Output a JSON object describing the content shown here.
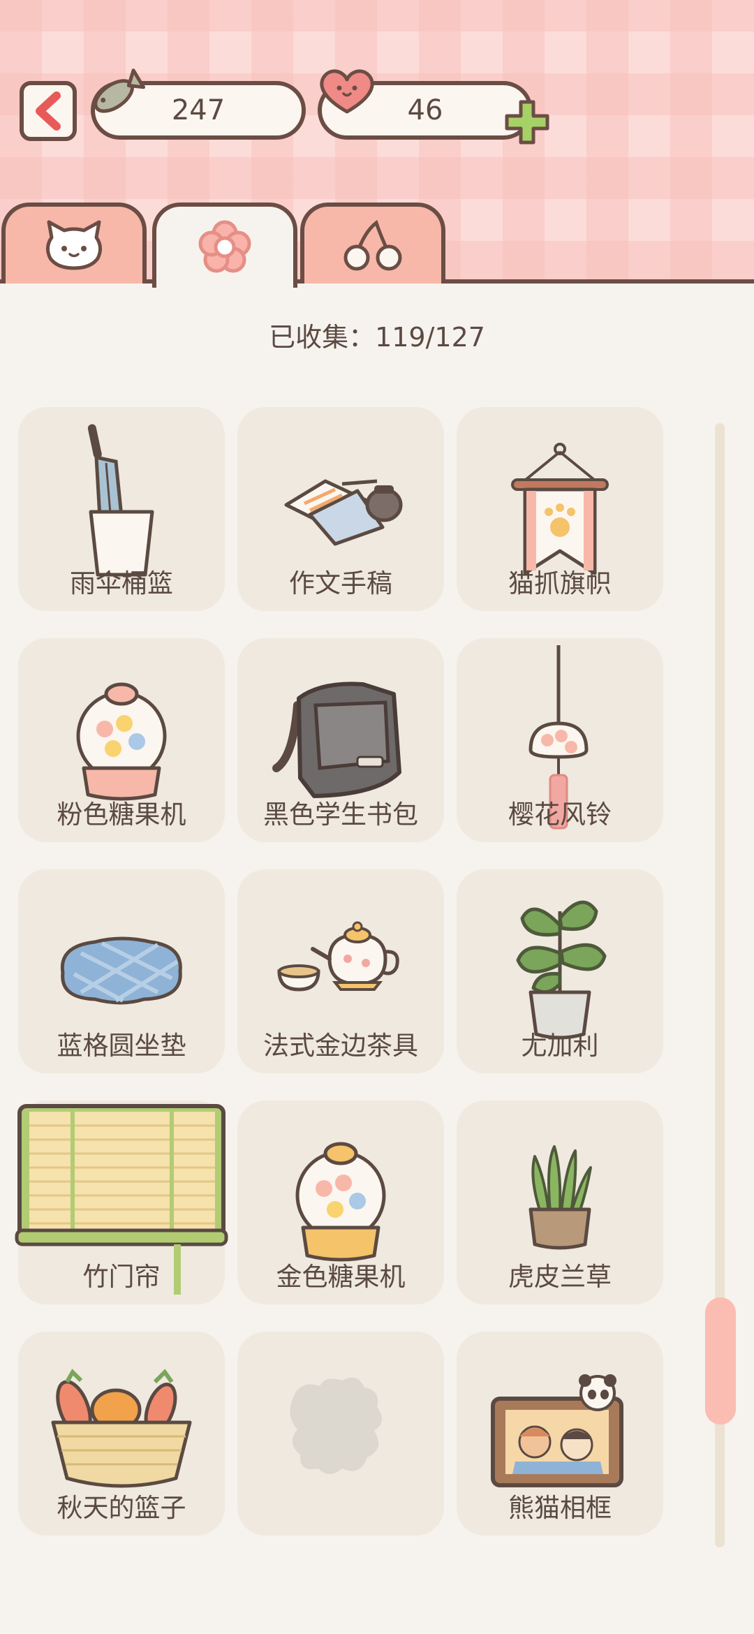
{
  "currency": {
    "fish_count": "247",
    "heart_count": "46"
  },
  "tabs": [
    {
      "icon": "cat-icon",
      "active": false
    },
    {
      "icon": "flower-icon",
      "active": true
    },
    {
      "icon": "cherry-icon",
      "active": false
    }
  ],
  "collection": {
    "collected_text": "已收集：119/127"
  },
  "items": [
    {
      "name": "雨伞桶篮",
      "icon": "umbrella-bucket-icon"
    },
    {
      "name": "作文手稿",
      "icon": "manuscript-icon"
    },
    {
      "name": "猫抓旗帜",
      "icon": "cat-paw-banner-icon"
    },
    {
      "name": "粉色糖果机",
      "icon": "pink-gumball-machine-icon"
    },
    {
      "name": "黑色学生书包",
      "icon": "black-school-bag-icon"
    },
    {
      "name": "樱花风铃",
      "icon": "sakura-wind-chime-icon"
    },
    {
      "name": "蓝格圆坐垫",
      "icon": "blue-cushion-icon"
    },
    {
      "name": "法式金边茶具",
      "icon": "tea-set-icon"
    },
    {
      "name": "尤加利",
      "icon": "eucalyptus-plant-icon"
    },
    {
      "name": "竹门帘",
      "icon": "bamboo-curtain-icon"
    },
    {
      "name": "金色糖果机",
      "icon": "gold-gumball-machine-icon"
    },
    {
      "name": "虎皮兰草",
      "icon": "snake-plant-icon"
    },
    {
      "name": "秋天的篮子",
      "icon": "autumn-basket-icon"
    },
    {
      "name": "",
      "icon": "locked-item-silhouette-icon"
    },
    {
      "name": "熊猫相框",
      "icon": "panda-photo-frame-icon"
    }
  ],
  "colors": {
    "outline": "#6b4d44",
    "header_pink": "#fcdcd8",
    "tab_pink": "#f7b8a9",
    "card_bg": "#efe9df",
    "page_bg": "#f6f3ee",
    "scroll_thumb": "#fbbcb1",
    "plus_green": "#a6d166"
  }
}
